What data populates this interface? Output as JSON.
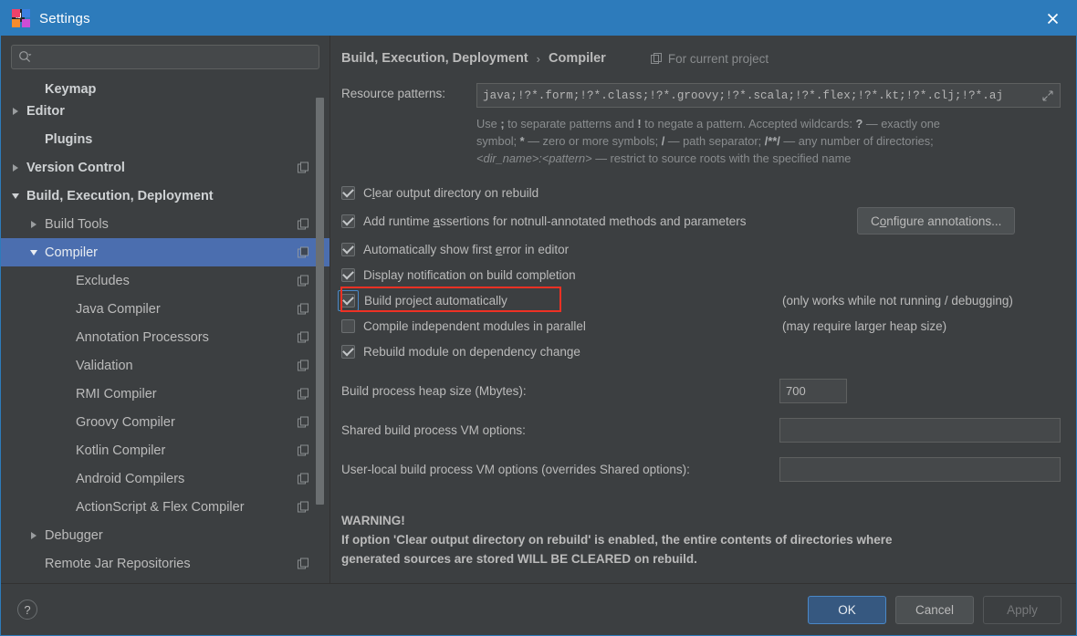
{
  "window": {
    "title": "Settings",
    "logo_text": "IJ",
    "close_label": "×"
  },
  "sidebar": {
    "search": {
      "value": "",
      "placeholder": ""
    },
    "items": [
      {
        "label": "Keymap",
        "indent": 1,
        "arrow": "none",
        "bold": true,
        "badge": false,
        "selected": false,
        "clipped": true
      },
      {
        "label": "Editor",
        "indent": 0,
        "arrow": "right",
        "bold": true,
        "badge": false,
        "selected": false
      },
      {
        "label": "Plugins",
        "indent": 1,
        "arrow": "none",
        "bold": true,
        "badge": false,
        "selected": false
      },
      {
        "label": "Version Control",
        "indent": 0,
        "arrow": "right",
        "bold": true,
        "badge": true,
        "selected": false
      },
      {
        "label": "Build, Execution, Deployment",
        "indent": 0,
        "arrow": "down",
        "bold": true,
        "badge": false,
        "selected": false
      },
      {
        "label": "Build Tools",
        "indent": 1,
        "arrow": "right",
        "bold": false,
        "badge": true,
        "selected": false
      },
      {
        "label": "Compiler",
        "indent": 1,
        "arrow": "down",
        "bold": false,
        "badge": true,
        "selected": true
      },
      {
        "label": "Excludes",
        "indent": 2,
        "arrow": "none",
        "bold": false,
        "badge": true,
        "selected": false
      },
      {
        "label": "Java Compiler",
        "indent": 2,
        "arrow": "none",
        "bold": false,
        "badge": true,
        "selected": false
      },
      {
        "label": "Annotation Processors",
        "indent": 2,
        "arrow": "none",
        "bold": false,
        "badge": true,
        "selected": false
      },
      {
        "label": "Validation",
        "indent": 2,
        "arrow": "none",
        "bold": false,
        "badge": true,
        "selected": false
      },
      {
        "label": "RMI Compiler",
        "indent": 2,
        "arrow": "none",
        "bold": false,
        "badge": true,
        "selected": false
      },
      {
        "label": "Groovy Compiler",
        "indent": 2,
        "arrow": "none",
        "bold": false,
        "badge": true,
        "selected": false
      },
      {
        "label": "Kotlin Compiler",
        "indent": 2,
        "arrow": "none",
        "bold": false,
        "badge": true,
        "selected": false
      },
      {
        "label": "Android Compilers",
        "indent": 2,
        "arrow": "none",
        "bold": false,
        "badge": true,
        "selected": false
      },
      {
        "label": "ActionScript & Flex Compiler",
        "indent": 2,
        "arrow": "none",
        "bold": false,
        "badge": true,
        "selected": false
      },
      {
        "label": "Debugger",
        "indent": 1,
        "arrow": "right",
        "bold": false,
        "badge": false,
        "selected": false
      },
      {
        "label": "Remote Jar Repositories",
        "indent": 1,
        "arrow": "none",
        "bold": false,
        "badge": true,
        "selected": false
      }
    ]
  },
  "main": {
    "breadcrumb": {
      "root": "Build, Execution, Deployment",
      "separator": "›",
      "leaf": "Compiler",
      "scope": "For current project"
    },
    "resource_patterns": {
      "label": "Resource patterns:",
      "value": "java;!?*.form;!?*.class;!?*.groovy;!?*.scala;!?*.flex;!?*.kt;!?*.clj;!?*.aj"
    },
    "help": {
      "line1_a": "Use ",
      "line1_semicolon": ";",
      "line1_b": " to separate patterns and ",
      "line1_bang": "!",
      "line1_c": " to negate a pattern. Accepted wildcards: ",
      "line1_q": "?",
      "line1_d": " — exactly one",
      "line2_a": "symbol; ",
      "line2_star": "*",
      "line2_b": " — zero or more symbols; ",
      "line2_slash": "/",
      "line2_c": " — path separator; ",
      "line2_dstar": "/**/",
      "line2_d": " — any number of directories;",
      "line3_i1": "<dir_name>:<pattern>",
      "line3_b": " — restrict to source roots with the specified name"
    },
    "checkboxes": [
      {
        "label_pre": "C",
        "label_mn": "l",
        "label_post": "ear output directory on rebuild",
        "checked": true,
        "focused": false,
        "note": "",
        "button": ""
      },
      {
        "label_pre": "Add runtime ",
        "label_mn": "a",
        "label_post": "ssertions for notnull-annotated methods and parameters",
        "checked": true,
        "focused": false,
        "note": "",
        "button": "Configure annotations..."
      },
      {
        "label_pre": "Automatically show first ",
        "label_mn": "e",
        "label_post": "rror in editor",
        "checked": true,
        "focused": false,
        "note": "",
        "button": ""
      },
      {
        "label_pre": "Display notification on build completion",
        "label_mn": "",
        "label_post": "",
        "checked": true,
        "focused": false,
        "note": "",
        "button": ""
      },
      {
        "label_pre": "Build project automatically",
        "label_mn": "",
        "label_post": "",
        "checked": true,
        "focused": true,
        "note": "(only works while not running / debugging)",
        "button": ""
      },
      {
        "label_pre": "Compile independent modules in parallel",
        "label_mn": "",
        "label_post": "",
        "checked": false,
        "focused": false,
        "note": "(may require larger heap size)",
        "button": ""
      },
      {
        "label_pre": "Rebuild module on dependency change",
        "label_mn": "",
        "label_post": "",
        "checked": true,
        "focused": false,
        "note": "",
        "button": ""
      }
    ],
    "configure_annotations_button": {
      "pre": "C",
      "mnemonic": "o",
      "post": "nfigure annotations..."
    },
    "heap": {
      "label": "Build process heap size (Mbytes):",
      "value": "700"
    },
    "shared_vm": {
      "label": "Shared build process VM options:",
      "value": ""
    },
    "userlocal_vm": {
      "label": "User-local build process VM options (overrides Shared options):",
      "value": ""
    },
    "warning": {
      "title": "WARNING!",
      "line1": "If option 'Clear output directory on rebuild' is enabled, the entire contents of directories where",
      "line2": "generated sources are stored WILL BE CLEARED on rebuild."
    }
  },
  "footer": {
    "help": "?",
    "ok": "OK",
    "cancel": "Cancel",
    "apply": "Apply"
  },
  "colors": {
    "titlebar": "#2d7bbb",
    "background": "#3c3f41",
    "selection": "#4b6eaf",
    "accent_focus": "#4a88c7",
    "highlight_box": "#ee3124",
    "text": "#bbbbbb",
    "muted_text": "#8a8d8f"
  }
}
